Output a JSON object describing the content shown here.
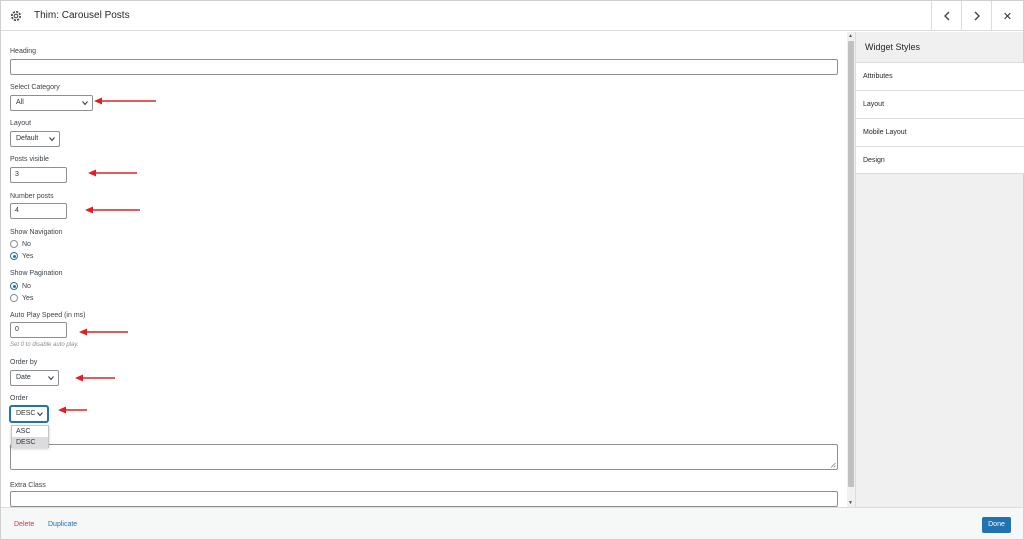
{
  "header": {
    "title": "Thim: Carousel Posts",
    "prev_icon": "‹",
    "next_icon": "›",
    "close_icon": "✕"
  },
  "form": {
    "heading_label": "Heading",
    "heading_value": "",
    "category_label": "Select Category",
    "category_value": "All",
    "layout_label": "Layout",
    "layout_value": "Default",
    "posts_visible_label": "Posts visible",
    "posts_visible_value": "3",
    "number_posts_label": "Number posts",
    "number_posts_value": "4",
    "show_navigation_label": "Show Navigation",
    "show_navigation_options": [
      "No",
      "Yes"
    ],
    "show_navigation_selected": "Yes",
    "show_pagination_label": "Show Pagination",
    "show_pagination_options": [
      "No",
      "Yes"
    ],
    "show_pagination_selected": "No",
    "autoplay_label": "Auto Play Speed (in ms)",
    "autoplay_value": "0",
    "autoplay_help": "Set 0 to disable auto play.",
    "order_by_label": "Order by",
    "order_by_value": "Date",
    "order_label": "Order",
    "order_value": "DESC",
    "order_options": [
      "ASC",
      "DESC"
    ],
    "extra_class_label": "Extra Class"
  },
  "sidebar": {
    "title": "Widget Styles",
    "items": [
      "Attributes",
      "Layout",
      "Mobile Layout",
      "Design"
    ]
  },
  "footer": {
    "delete": "Delete",
    "duplicate": "Duplicate",
    "done": "Done"
  },
  "colors": {
    "accent": "#2271b1",
    "danger": "#d63638",
    "arrow": "#e02020"
  }
}
